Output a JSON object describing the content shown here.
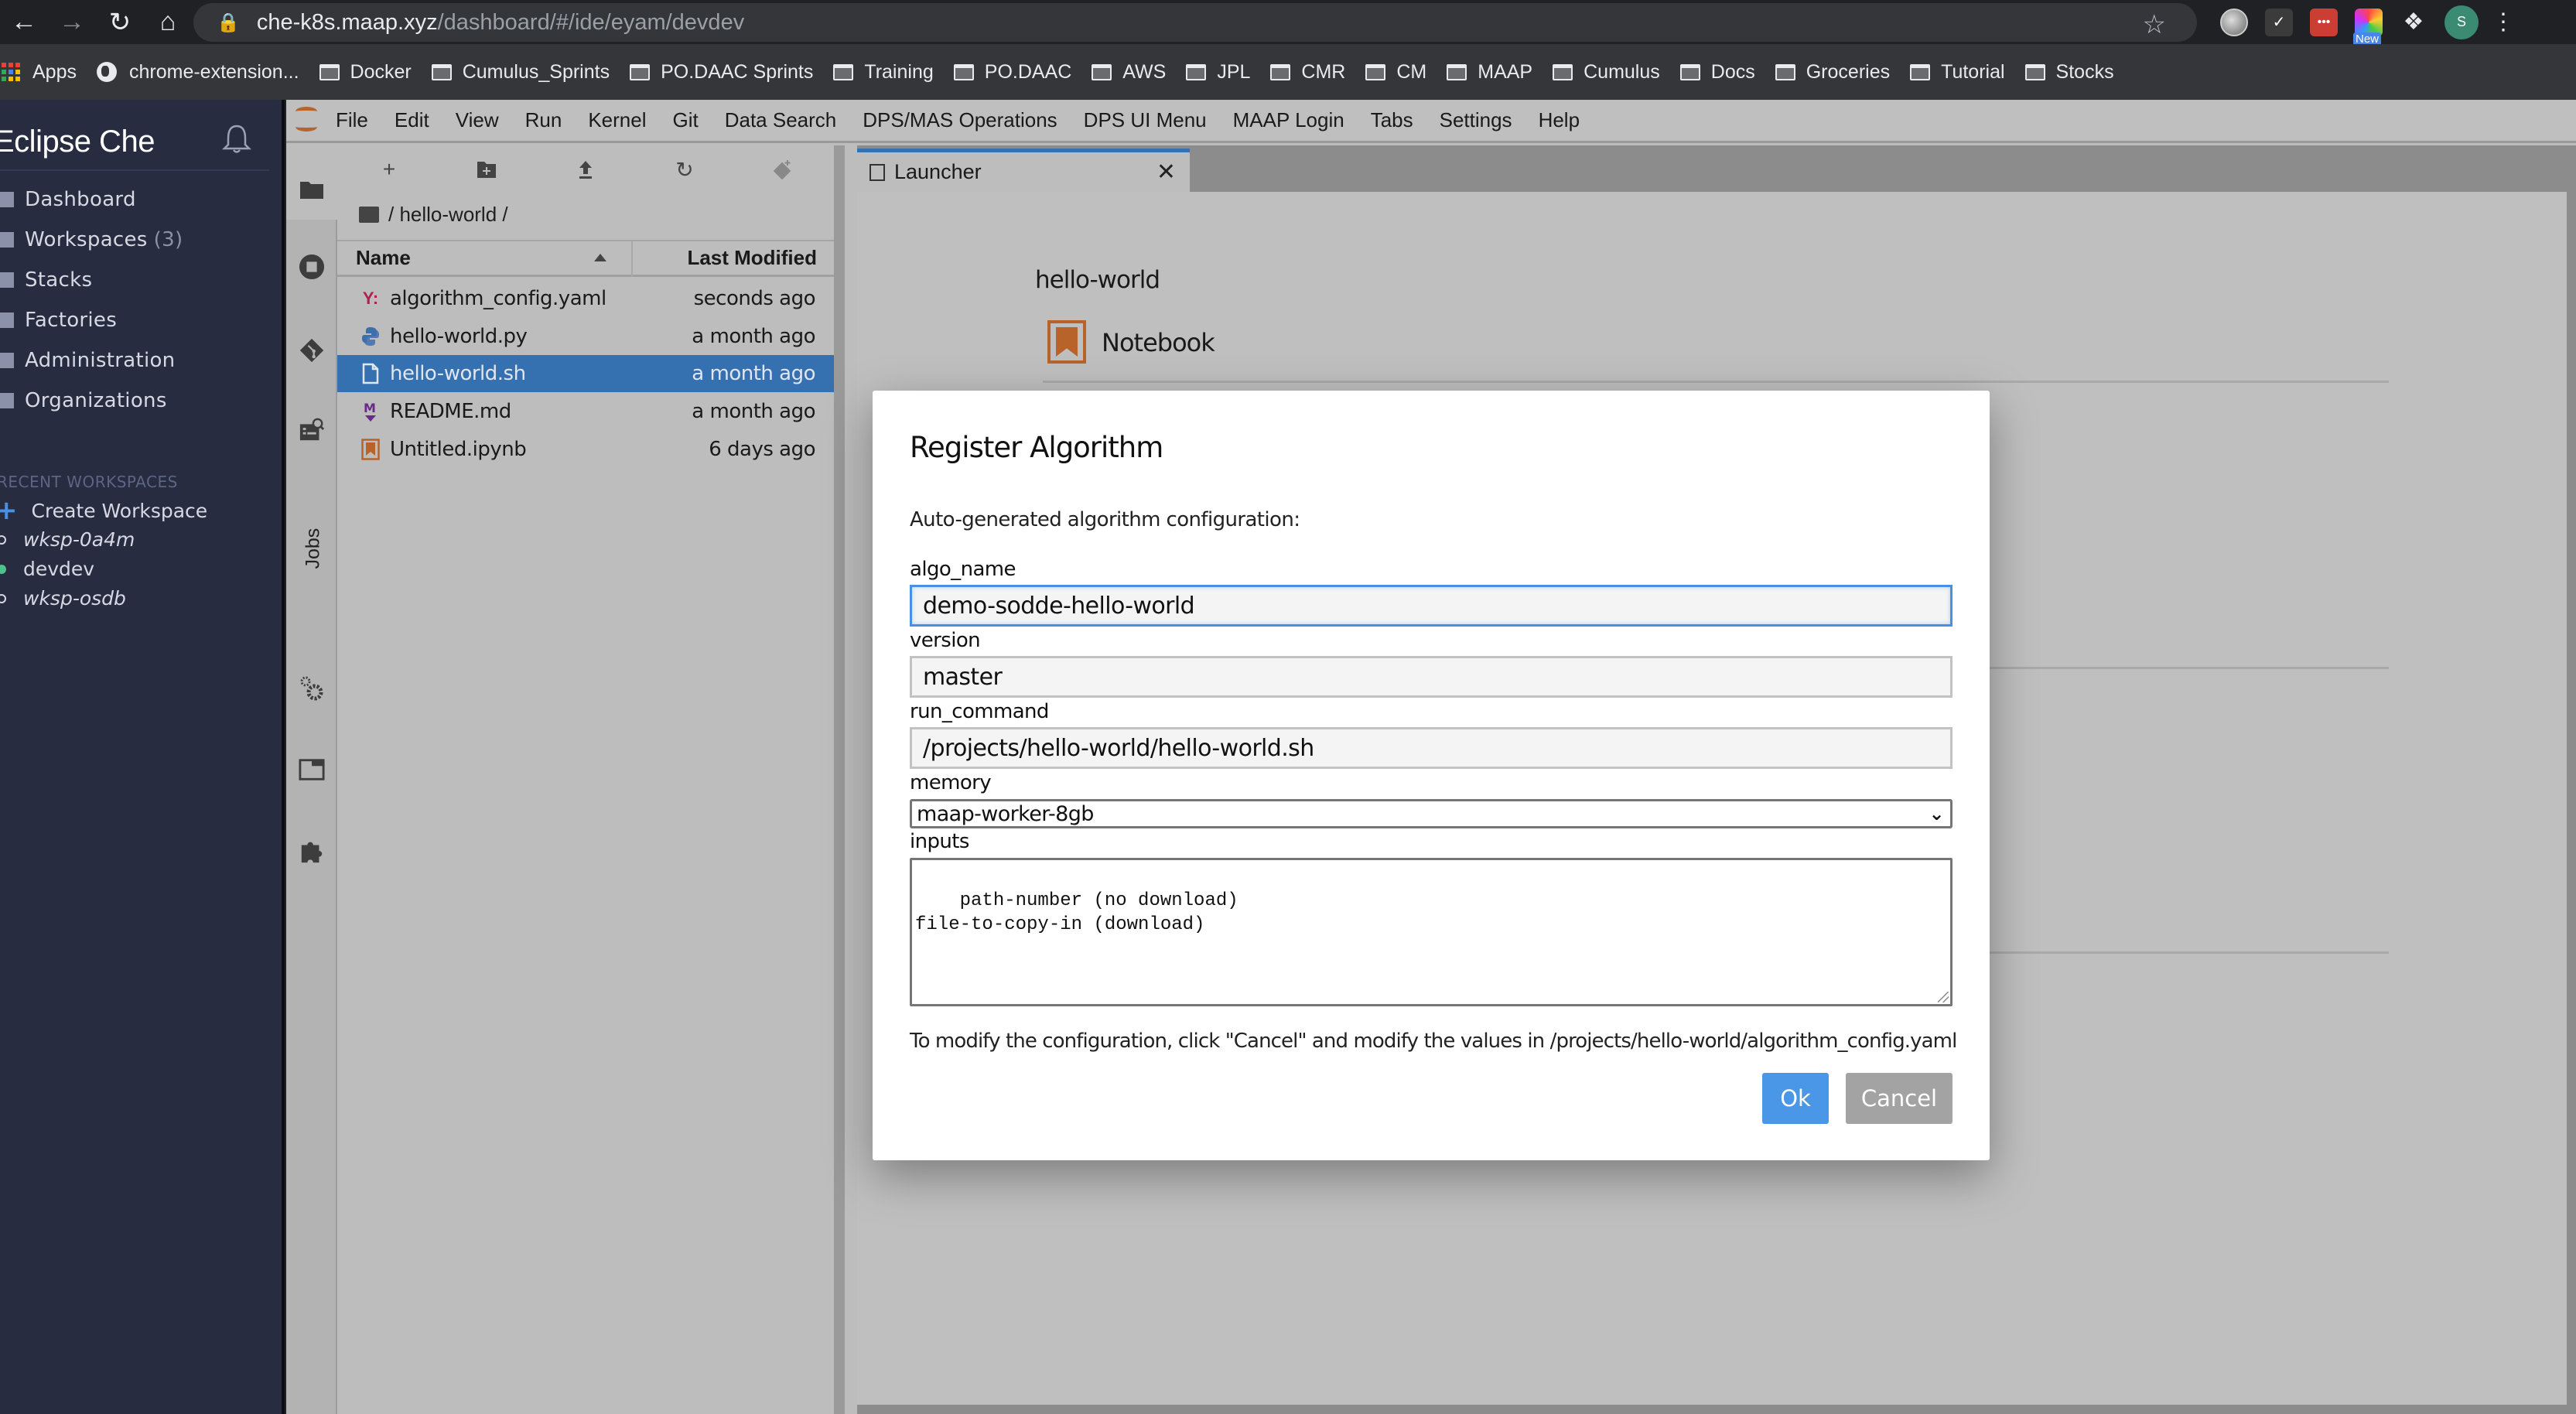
{
  "browser": {
    "url_host": "che-k8s.maap.xyz",
    "url_path": "/dashboard/#/ide/eyam/devdev",
    "extension_badge": "New",
    "profile_initial": "S",
    "bookmarks": [
      {
        "label": "Apps",
        "icon": "apps-grid-icon"
      },
      {
        "label": "chrome-extension...",
        "icon": "globe-icon"
      },
      {
        "label": "Docker",
        "icon": "folder-icon"
      },
      {
        "label": "Cumulus_Sprints",
        "icon": "folder-icon"
      },
      {
        "label": "PO.DAAC Sprints",
        "icon": "folder-icon"
      },
      {
        "label": "Training",
        "icon": "folder-icon"
      },
      {
        "label": "PO.DAAC",
        "icon": "folder-icon"
      },
      {
        "label": "AWS",
        "icon": "folder-icon"
      },
      {
        "label": "JPL",
        "icon": "folder-icon"
      },
      {
        "label": "CMR",
        "icon": "folder-icon"
      },
      {
        "label": "CM",
        "icon": "folder-icon"
      },
      {
        "label": "MAAP",
        "icon": "folder-icon"
      },
      {
        "label": "Cumulus",
        "icon": "folder-icon"
      },
      {
        "label": "Docs",
        "icon": "folder-icon"
      },
      {
        "label": "Groceries",
        "icon": "folder-icon"
      },
      {
        "label": "Tutorial",
        "icon": "folder-icon"
      },
      {
        "label": "Stocks",
        "icon": "folder-icon"
      }
    ]
  },
  "che": {
    "title": "Eclipse Che",
    "nav": [
      {
        "label": "Dashboard",
        "icon": "dashboard-icon"
      },
      {
        "label": "Workspaces",
        "count": "(3)",
        "icon": "cube-icon"
      },
      {
        "label": "Stacks",
        "icon": "stacks-icon"
      },
      {
        "label": "Factories",
        "icon": "rocket-icon"
      },
      {
        "label": "Administration",
        "icon": "gear-icon"
      },
      {
        "label": "Organizations",
        "icon": "org-icon"
      }
    ],
    "recent_label": "RECENT WORKSPACES",
    "recent": [
      {
        "label": "Create Workspace",
        "status": "create"
      },
      {
        "label": "wksp-0a4m",
        "status": "stopped"
      },
      {
        "label": "devdev",
        "status": "running"
      },
      {
        "label": "wksp-osdb",
        "status": "stopped"
      }
    ]
  },
  "jupyter": {
    "menu": [
      "File",
      "Edit",
      "View",
      "Run",
      "Kernel",
      "Git",
      "Data Search",
      "DPS/MAS Operations",
      "DPS UI Menu",
      "MAAP Login",
      "Tabs",
      "Settings",
      "Help"
    ],
    "side_strip": {
      "jobs_label": "Jobs"
    },
    "filebrowser": {
      "breadcrumb": "/ hello-world /",
      "col_name": "Name",
      "col_modified": "Last Modified",
      "files": [
        {
          "name": "algorithm_config.yaml",
          "modified": "seconds ago",
          "type": "yaml",
          "selected": false
        },
        {
          "name": "hello-world.py",
          "modified": "a month ago",
          "type": "python",
          "selected": false
        },
        {
          "name": "hello-world.sh",
          "modified": "a month ago",
          "type": "file",
          "selected": true
        },
        {
          "name": "README.md",
          "modified": "a month ago",
          "type": "markdown",
          "selected": false
        },
        {
          "name": "Untitled.ipynb",
          "modified": "6 days ago",
          "type": "notebook",
          "selected": false
        }
      ]
    },
    "tab": {
      "label": "Launcher"
    },
    "launcher": {
      "cwd": "hello-world",
      "notebook_label": "Notebook"
    }
  },
  "dialog": {
    "title": "Register Algorithm",
    "subtitle": "Auto-generated algorithm configuration:",
    "fields": {
      "algo_name": {
        "label": "algo_name",
        "value": "demo-sodde-hello-world"
      },
      "version": {
        "label": "version",
        "value": "master"
      },
      "run_command": {
        "label": "run_command",
        "value": "/projects/hello-world/hello-world.sh"
      },
      "memory": {
        "label": "memory",
        "value": "maap-worker-8gb"
      },
      "inputs": {
        "label": "inputs",
        "value": "path-number (no download)\nfile-to-copy-in (download)"
      }
    },
    "note": "To modify the configuration, click \"Cancel\" and modify the values in /projects/hello-world/algorithm_config.yaml",
    "ok_label": "Ok",
    "cancel_label": "Cancel"
  },
  "colors": {
    "che_sidebar_bg": "#272c40",
    "accent_blue": "#4a97e8",
    "selection_blue": "#3570b0",
    "running_green": "#4dc28a",
    "jupyter_orange": "#b8632a"
  }
}
